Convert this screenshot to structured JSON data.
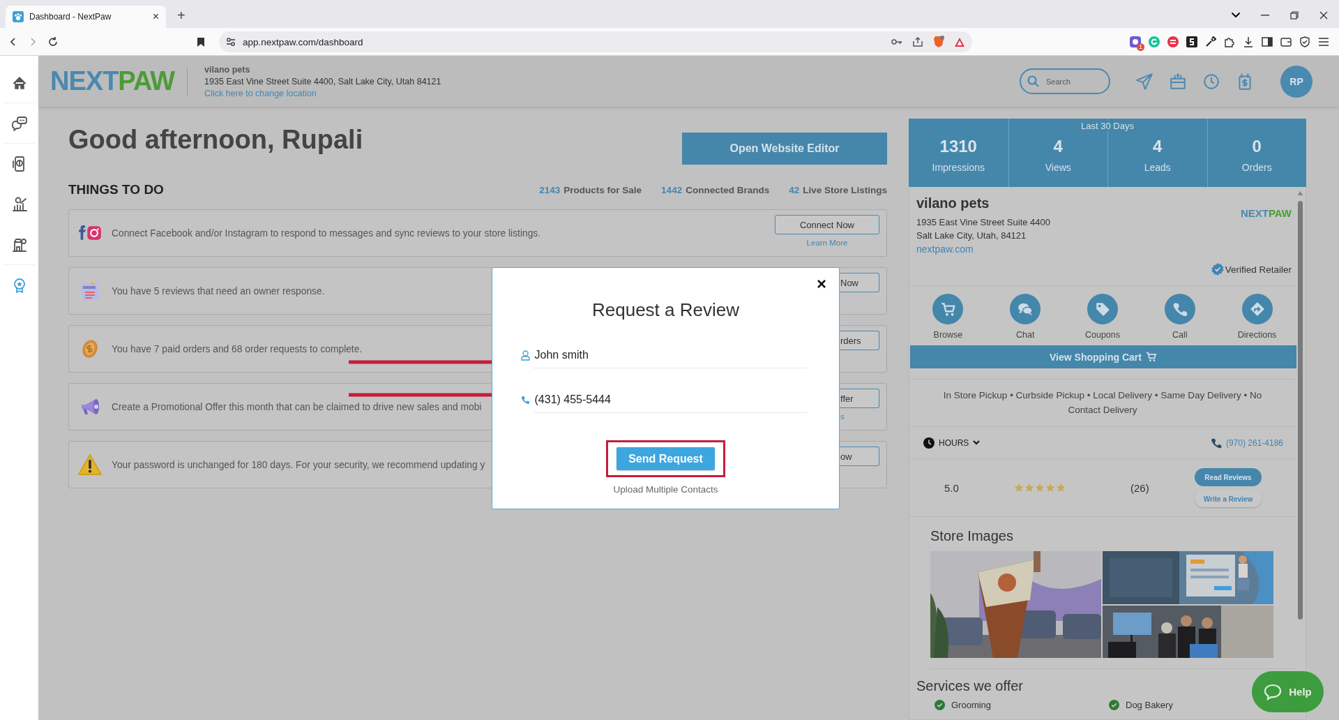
{
  "browser": {
    "tab_title": "Dashboard - NextPaw",
    "tab_close": "×",
    "new_tab": "+",
    "url": "app.nextpaw.com/dashboard",
    "extension_badge": "1"
  },
  "sidebar": {
    "items": [
      {
        "selected": false
      },
      {
        "selected": false
      },
      {
        "selected": false
      },
      {
        "selected": false
      },
      {
        "selected": false
      },
      {
        "selected": true
      }
    ]
  },
  "header": {
    "logo": [
      "NEXT",
      "PAW"
    ],
    "store_name": "vilano pets",
    "address": "1935 East Vine Street Suite 4400, Salt Lake City, Utah 84121",
    "change_location": "Click here to change location",
    "search": {
      "placeholder": "Search"
    },
    "avatar": "RP"
  },
  "greeting": "Good afternoon, Rupali",
  "website_editor_button": "Open Website Editor",
  "todo": {
    "title": "THINGS TO DO",
    "stats": [
      {
        "value": "2143",
        "label": "Products for Sale"
      },
      {
        "value": "1442",
        "label": "Connected Brands"
      },
      {
        "value": "42",
        "label": "Live Store Listings"
      }
    ],
    "items": [
      {
        "text": "Connect Facebook and/or Instagram to respond to messages and sync reviews to your store listings.",
        "button": "Connect Now",
        "link": "Learn More",
        "cut": false
      },
      {
        "text": "You have 5 reviews that need an owner response.",
        "button": "Now",
        "cut": true
      },
      {
        "text": "You have 7 paid orders and 68 order requests to complete.",
        "button": "rders",
        "cut": true
      },
      {
        "text": "Create a Promotional Offer this month that can be claimed to drive new sales and mobi",
        "button": "ffer",
        "link": "s",
        "cut": true
      },
      {
        "text": "Your password is unchanged for 180 days. For your security, we recommend updating y",
        "button": "ow",
        "cut": true
      }
    ]
  },
  "stats_panel": {
    "caption": "Last 30 Days",
    "items": [
      {
        "value": "1310",
        "label": "Impressions"
      },
      {
        "value": "4",
        "label": "Views"
      },
      {
        "value": "4",
        "label": "Leads"
      },
      {
        "value": "0",
        "label": "Orders"
      }
    ]
  },
  "store_card": {
    "name": "vilano pets",
    "address_lines": [
      "1935 East Vine Street Suite 4400",
      "Salt Lake City, Utah, 84121"
    ],
    "website": "nextpaw.com",
    "logo": [
      "NEXT",
      "PAW"
    ],
    "verified": "Verified Retailer",
    "actions": [
      "Browse",
      "Chat",
      "Coupons",
      "Call",
      "Directions"
    ],
    "cart_button": "View Shopping Cart",
    "delivery": "In Store Pickup • Curbside Pickup • Local Delivery • Same Day Delivery • No Contact Delivery",
    "hours": "HOURS",
    "phone": "(970) 261-4186",
    "rating": {
      "score": "5.0",
      "stars": 5,
      "count": "(26)",
      "read_button": "Read Reviews",
      "write_button": "Write a Review"
    },
    "images": {
      "title": "Store Images"
    },
    "services": {
      "title": "Services we offer",
      "items": [
        "Grooming",
        "Dog Bakery"
      ]
    }
  },
  "modal": {
    "title": "Request a Review",
    "close": "×",
    "name": "John smith",
    "phone": "(431) 455-5444",
    "send_button": "Send Request",
    "upload_link": "Upload Multiple Contacts"
  },
  "help_button": "Help"
}
